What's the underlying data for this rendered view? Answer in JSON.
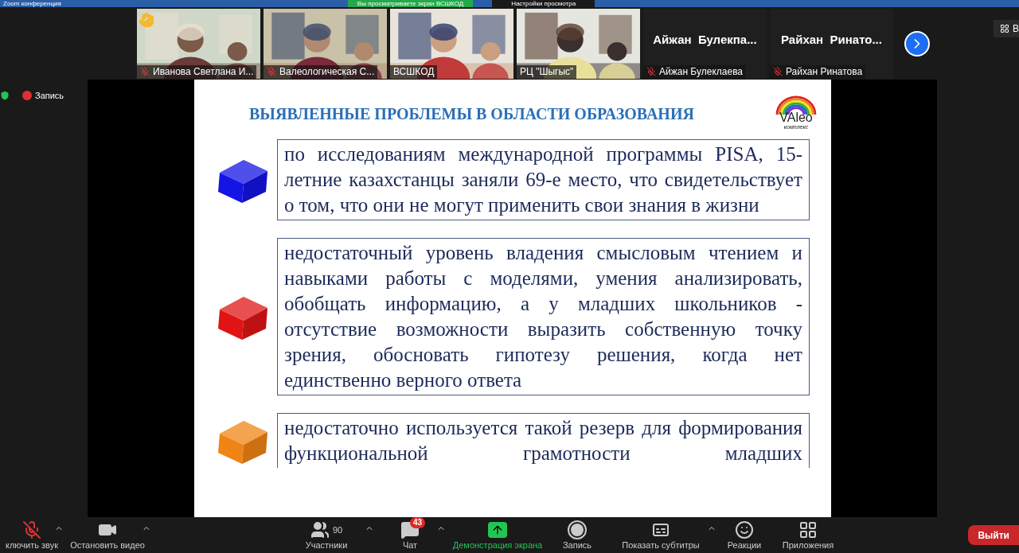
{
  "window": {
    "title": "Zoom конференция"
  },
  "share_banner": {
    "text": "Вы просматриваете экран ВСШКОД",
    "menu": "Настройки просмотра"
  },
  "view_button": "В",
  "thumbnails": [
    {
      "kind": "video",
      "name": "Иванова Светлана И...",
      "muted": true,
      "hand_raised": true
    },
    {
      "kind": "video",
      "name": "Валеологическая С...",
      "muted": true,
      "hand_raised": false
    },
    {
      "kind": "video",
      "name": "ВСШКОД",
      "muted": false,
      "hand_raised": false
    },
    {
      "kind": "video",
      "name": "РЦ \"Шыгыс\"",
      "muted": false,
      "hand_raised": false
    },
    {
      "kind": "avatar",
      "display": "Айжан  Булекпа...",
      "name": "Айжан Булеклаева",
      "muted": true,
      "hand_raised": false
    },
    {
      "kind": "avatar",
      "display": "Райхан  Ринато...",
      "name": "Райхан  Ринатова",
      "muted": true,
      "hand_raised": false
    }
  ],
  "recording": {
    "label": "Запись"
  },
  "slide": {
    "title": "ВЫЯВЛЕННЫЕ ПРОБЛЕМЫ В ОБЛАСТИ ОБРАЗОВАНИЯ",
    "logo": {
      "text": "VAleo",
      "subtitle": "комплекс"
    },
    "items": [
      {
        "color": "#1414e6",
        "text": "по исследованиям международной программы PISA, 15-летние казахстанцы заняли 69-е место, что свидетельствует о том, что они не могут применить свои знания в жизни"
      },
      {
        "color": "#e01414",
        "text": "недостаточный уровень владения смысловым чтением и навыками работы с моделями, умения анализировать, обобщать информацию, а у младших школьников - отсутствие возможности выразить собственную точку зрения, обосновать гипотезу решения, когда нет единственно верного ответа"
      },
      {
        "color": "#f08414",
        "text": "недостаточно используется такой резерв для формирования функциональной грамотности младших"
      }
    ]
  },
  "toolbar": {
    "items": [
      {
        "kind": "mic",
        "label": "ключить звук",
        "caret": true
      },
      {
        "kind": "video",
        "label": "Остановить видео",
        "caret": true
      },
      {
        "kind": "participants",
        "label": "Участники",
        "count": "90",
        "caret": true
      },
      {
        "kind": "chat",
        "label": "Чат",
        "badge": "43",
        "caret": true
      },
      {
        "kind": "share",
        "label": "Демонстрация экрана",
        "caret": false
      },
      {
        "kind": "record",
        "label": "Запись",
        "caret": false
      },
      {
        "kind": "captions",
        "label": "Показать субтитры",
        "caret": true
      },
      {
        "kind": "reactions",
        "label": "Реакции",
        "caret": false
      },
      {
        "kind": "apps",
        "label": "Приложения",
        "caret": false
      }
    ],
    "exit": "Выйти"
  }
}
